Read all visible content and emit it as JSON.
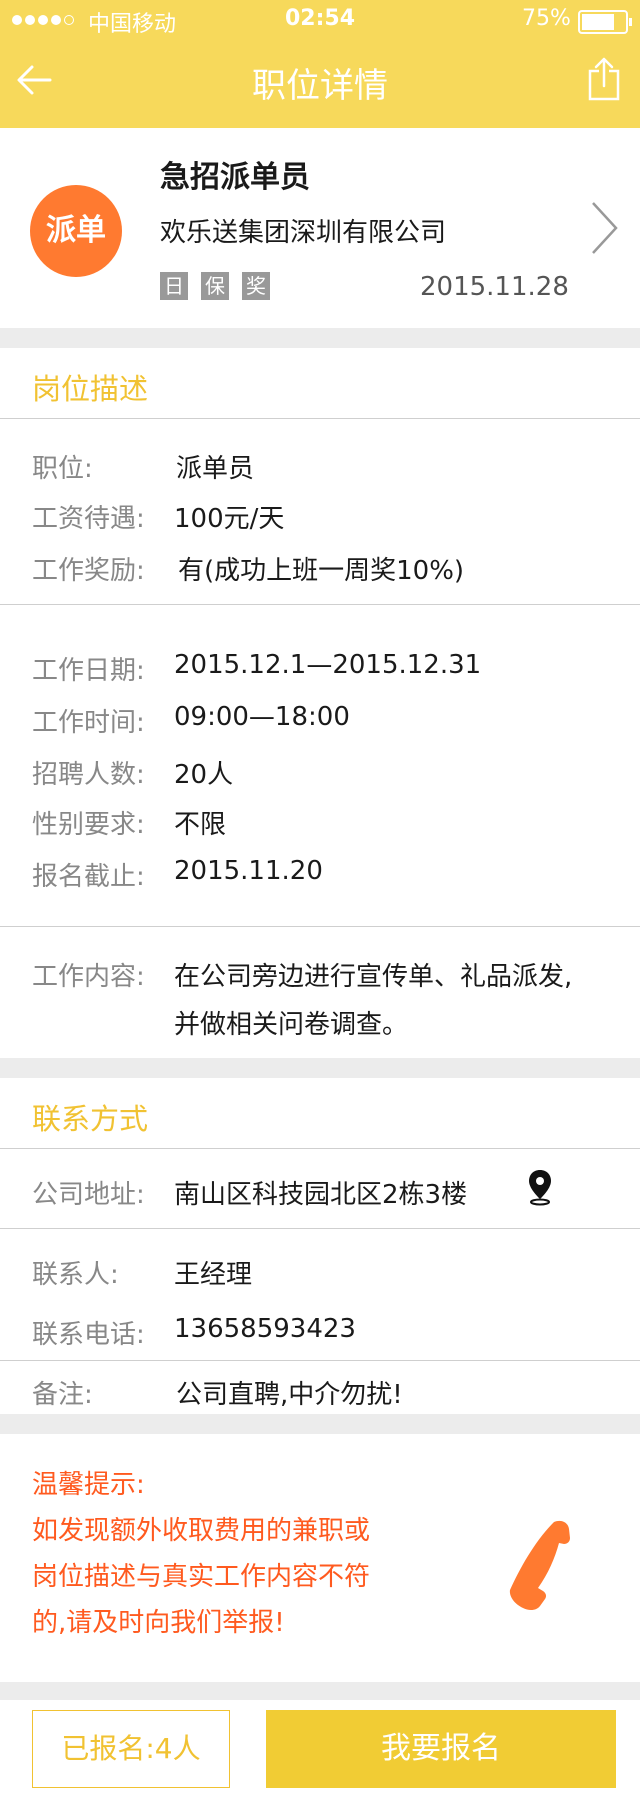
{
  "status_bar": {
    "carrier": "中国移动",
    "time": "02:54",
    "battery": "75%"
  },
  "header": {
    "title": "职位详情"
  },
  "job": {
    "title": "急招派单员",
    "logo_text": "派单",
    "company": "欢乐送集团深圳有限公司",
    "tags": [
      "日",
      "保",
      "奖"
    ],
    "date": "2015.11.28"
  },
  "description": {
    "section_title": "岗位描述",
    "position_label": "职位:",
    "position_value": "派单员",
    "salary_label": "工资待遇:",
    "salary_value": "100元/天",
    "bonus_label": "工作奖励:",
    "bonus_value": "有(成功上班一周奖10%)",
    "date_label": "工作日期:",
    "date_value": "2015.12.1—2015.12.31",
    "time_label": "工作时间:",
    "time_value": "09:00—18:00",
    "headcount_label": "招聘人数:",
    "headcount_value": "20人",
    "gender_label": "性别要求:",
    "gender_value": "不限",
    "deadline_label": "报名截止:",
    "deadline_value": "2015.11.20",
    "content_label": "工作内容:",
    "content_line1": "在公司旁边进行宣传单、礼品派发,",
    "content_line2": "并做相关问卷调查。"
  },
  "contact": {
    "section_title": "联系方式",
    "address_label": "公司地址:",
    "address_value": "南山区科技园北区2栋3楼",
    "person_label": "联系人:",
    "person_value": "王经理",
    "phone_label": "联系电话:",
    "phone_value": "13658593423",
    "note_label": "备注:",
    "note_value": "公司直聘,中介勿扰!"
  },
  "notice": {
    "title": "温馨提示:",
    "line1": "如发现额外收取费用的兼职或",
    "line2": "岗位描述与真实工作内容不符",
    "line3": "的,请及时向我们举报!"
  },
  "bottom": {
    "registered": "已报名:4人",
    "apply_button": "我要报名"
  },
  "colors": {
    "header": "#f7d95b",
    "accent": "#f1c232",
    "logo": "#ff7a30",
    "warning": "#ff5a1f"
  }
}
